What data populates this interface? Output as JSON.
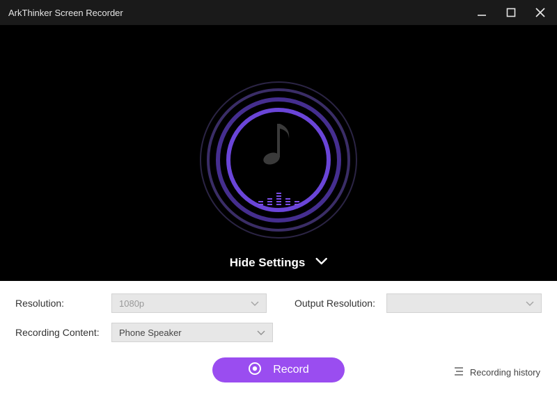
{
  "titlebar": {
    "title": "ArkThinker Screen Recorder"
  },
  "main": {
    "toggle_label": "Hide Settings"
  },
  "settings": {
    "resolution_label": "Resolution:",
    "resolution_value": "1080p",
    "output_resolution_label": "Output Resolution:",
    "output_resolution_value": "",
    "recording_content_label": "Recording Content:",
    "recording_content_value": "Phone Speaker"
  },
  "actions": {
    "record_label": "Record",
    "history_label": "Recording history"
  }
}
